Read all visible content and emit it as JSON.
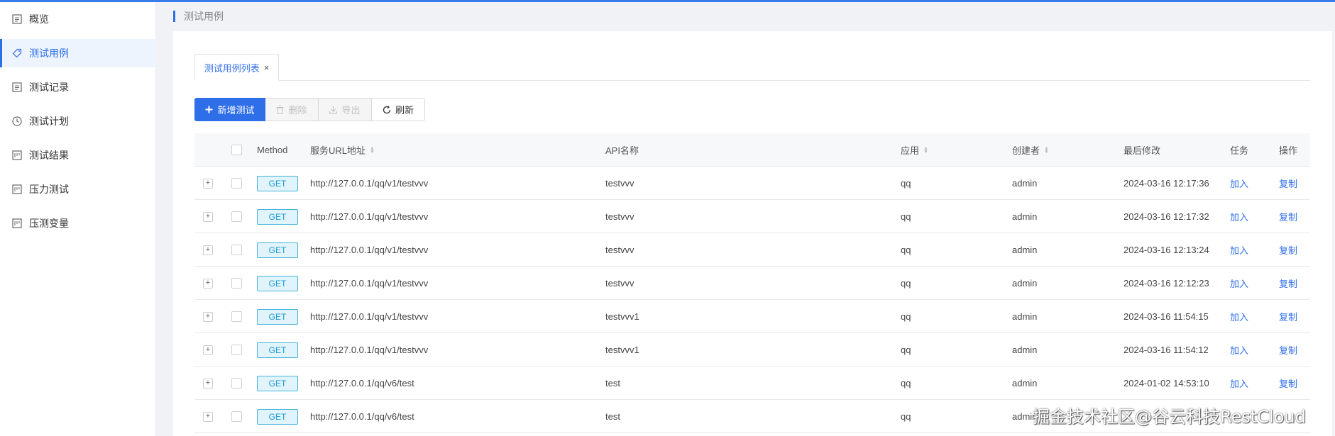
{
  "sidebar": {
    "items": [
      {
        "label": "概览",
        "icon": "list-icon"
      },
      {
        "label": "测试用例",
        "icon": "tag-icon",
        "active": true
      },
      {
        "label": "测试记录",
        "icon": "list-icon"
      },
      {
        "label": "测试计划",
        "icon": "clock-icon"
      },
      {
        "label": "测试结果",
        "icon": "chart-icon"
      },
      {
        "label": "压力测试",
        "icon": "chart-icon"
      },
      {
        "label": "压测变量",
        "icon": "chart-icon"
      }
    ]
  },
  "header": {
    "title": "测试用例"
  },
  "tab": {
    "label": "测试用例列表",
    "close": "×"
  },
  "toolbar": {
    "add_label": "新增测试",
    "delete_label": "删除",
    "export_label": "导出",
    "refresh_label": "刷新"
  },
  "table": {
    "columns": {
      "method": "Method",
      "url": "服务URL地址",
      "api": "API名称",
      "app": "应用",
      "creator": "创建者",
      "modified": "最后修改",
      "task": "任务",
      "action": "操作"
    },
    "rows": [
      {
        "method": "GET",
        "url": "http://127.0.0.1/qq/v1/testvvv",
        "api": "testvvv",
        "app": "qq",
        "creator": "admin",
        "modified": "2024-03-16 12:17:36",
        "task": "加入",
        "action": "复制"
      },
      {
        "method": "GET",
        "url": "http://127.0.0.1/qq/v1/testvvv",
        "api": "testvvv",
        "app": "qq",
        "creator": "admin",
        "modified": "2024-03-16 12:17:32",
        "task": "加入",
        "action": "复制"
      },
      {
        "method": "GET",
        "url": "http://127.0.0.1/qq/v1/testvvv",
        "api": "testvvv",
        "app": "qq",
        "creator": "admin",
        "modified": "2024-03-16 12:13:24",
        "task": "加入",
        "action": "复制"
      },
      {
        "method": "GET",
        "url": "http://127.0.0.1/qq/v1/testvvv",
        "api": "testvvv",
        "app": "qq",
        "creator": "admin",
        "modified": "2024-03-16 12:12:23",
        "task": "加入",
        "action": "复制"
      },
      {
        "method": "GET",
        "url": "http://127.0.0.1/qq/v1/testvvv",
        "api": "testvvv1",
        "app": "qq",
        "creator": "admin",
        "modified": "2024-03-16 11:54:15",
        "task": "加入",
        "action": "复制"
      },
      {
        "method": "GET",
        "url": "http://127.0.0.1/qq/v1/testvvv",
        "api": "testvvv1",
        "app": "qq",
        "creator": "admin",
        "modified": "2024-03-16 11:54:12",
        "task": "加入",
        "action": "复制"
      },
      {
        "method": "GET",
        "url": "http://127.0.0.1/qq/v6/test",
        "api": "test",
        "app": "qq",
        "creator": "admin",
        "modified": "2024-01-02 14:53:10",
        "task": "加入",
        "action": "复制"
      },
      {
        "method": "GET",
        "url": "http://127.0.0.1/qq/v6/test",
        "api": "test",
        "app": "qq",
        "creator": "admin",
        "modified": "",
        "task": "",
        "action": ""
      }
    ]
  },
  "watermark": "掘金技术社区@谷云科技RestCloud",
  "colors": {
    "accent": "#2f6ee9",
    "method_border": "#45b4dc",
    "method_bg": "#e1f3fb",
    "topbar": "#3a7bec"
  }
}
